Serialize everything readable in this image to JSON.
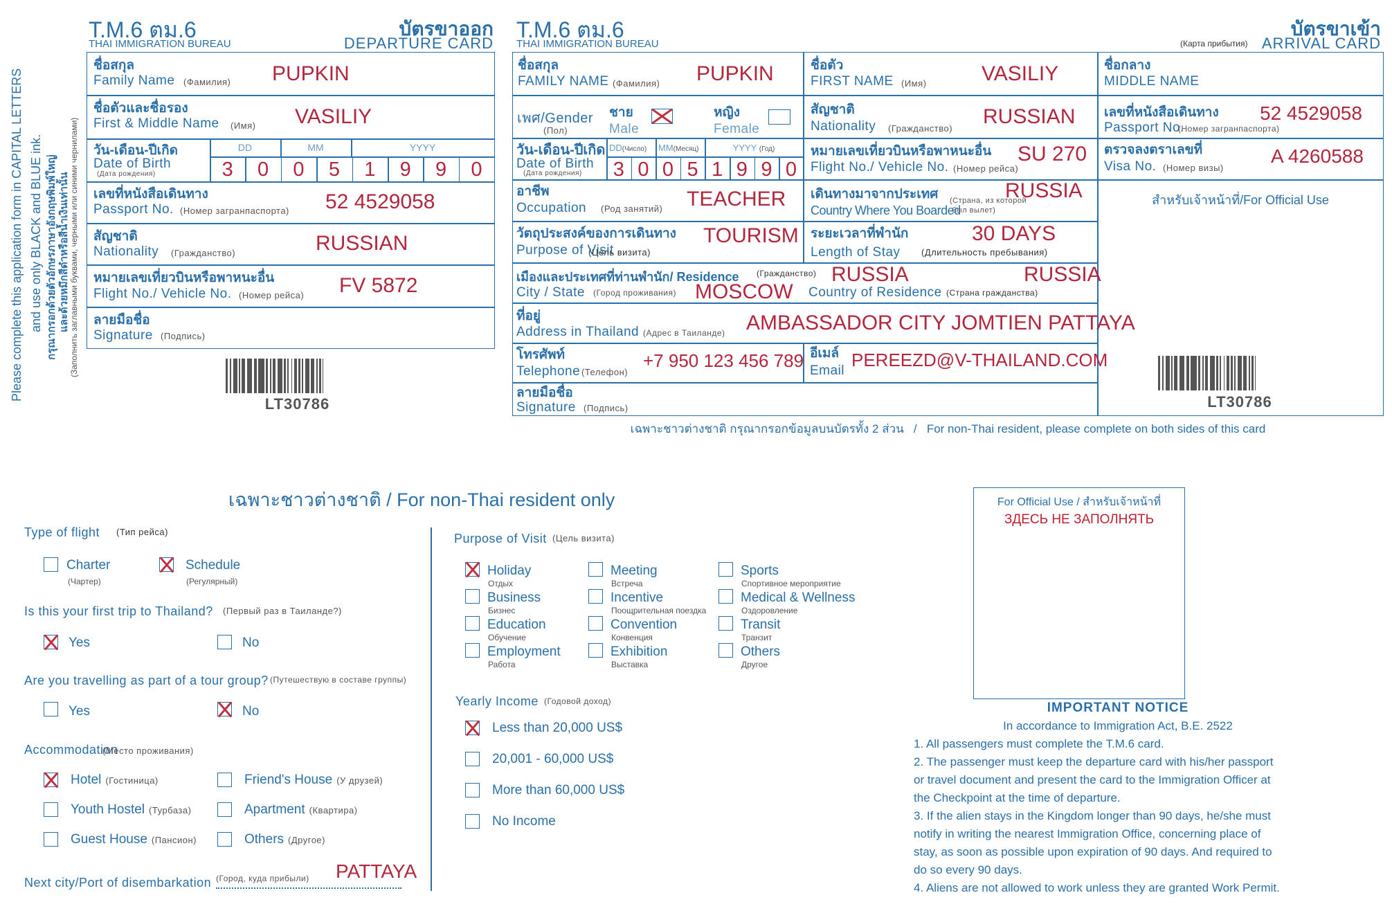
{
  "side_instructions": {
    "line1": "Please complete this application form in CAPITAL LETTERS",
    "line2": "and use only BLACK and BLUE ink.",
    "line3": "กรุณากรอกด้วยตัวอักษรภาษาอังกฤษพิมพ์ใหญ่",
    "line4": "และด้วยหมึกสีดำหรือสีน้ำเงินเท่านั้น",
    "line5": "(Заполнить заглавными буквами, черными или синими чернилами)"
  },
  "departure": {
    "form_code": "T.M.6  ตม.6",
    "bureau": "THAI IMMIGRATION BUREAU",
    "title_thai": "บัตรขาออก",
    "title_en": "DEPARTURE CARD",
    "fields": {
      "family_name": {
        "thai": "ชื่อสกุล",
        "en": "Family Name",
        "ru": "(Фамилия)",
        "value": "PUPKIN"
      },
      "first_name": {
        "thai": "ชื่อตัวและชื่อรอง",
        "en": "First & Middle Name",
        "ru": "(Имя)",
        "value": "VASILIY"
      },
      "dob": {
        "thai": "วัน-เดือน-ปีเกิด",
        "en": "Date of Birth",
        "ru": "(Дата рождения)",
        "dd_label": "DD",
        "mm_label": "MM",
        "yyyy_label": "YYYY",
        "digits": [
          "3",
          "0",
          "0",
          "5",
          "1",
          "9",
          "9",
          "0"
        ]
      },
      "passport": {
        "thai": "เลขที่หนังสือเดินทาง",
        "en": "Passport No.",
        "ru": "(Номер загранпаспорта)",
        "value": "52  4529058"
      },
      "nationality": {
        "thai": "สัญชาติ",
        "en": "Nationality",
        "ru": "(Гражданство)",
        "value": "RUSSIAN"
      },
      "flight": {
        "thai": "หมายเลขเที่ยวบินหรือพาหนะอื่น",
        "en": "Flight No./ Vehicle No.",
        "ru": "(Номер рейса)",
        "value": "FV 5872"
      },
      "signature": {
        "thai": "ลายมือชื่อ",
        "en": "Signature",
        "ru": "(Подпись)"
      }
    },
    "barcode": "LT30786"
  },
  "arrival": {
    "form_code": "T.M.6  ตม.6",
    "bureau": "THAI IMMIGRATION BUREAU",
    "title_thai": "บัตรขาเข้า",
    "title_ru": "(Карта прибытия)",
    "title_en": "ARRIVAL CARD",
    "fields": {
      "family_name": {
        "thai": "ชื่อสกุล",
        "en": "FAMILY NAME",
        "ru": "(Фамилия)",
        "value": "PUPKIN"
      },
      "first_name": {
        "thai": "ชื่อตัว",
        "en": "FIRST NAME",
        "ru": "(Имя)",
        "value": "VASILIY"
      },
      "middle_name": {
        "thai": "ชื่อกลาง",
        "en": "MIDDLE NAME",
        "value": ""
      },
      "gender": {
        "thai": "เพศ/Gender",
        "ru": "(Пол)",
        "male_thai": "ชาย",
        "male_en": "Male",
        "female_thai": "หญิง",
        "female_en": "Female",
        "male_checked": true,
        "female_checked": false
      },
      "nationality": {
        "thai": "สัญชาติ",
        "en": "Nationality",
        "ru": "(Гражданство)",
        "value": "RUSSIAN"
      },
      "passport": {
        "thai": "เลขที่หนังสือเดินทาง",
        "en": "Passport No.",
        "ru": "(Номер загранпаспорта)",
        "value": "52  4529058"
      },
      "dob": {
        "thai": "วัน-เดือน-ปีเกิด",
        "en": "Date of Birth",
        "ru": "(Дата рождения)",
        "dd_label": "DD",
        "dd_ru": "(Число)",
        "mm_label": "MM",
        "mm_ru": "(Месяц)",
        "yyyy_label": "YYYY",
        "yyyy_ru": "(Год)",
        "digits": [
          "3",
          "0",
          "0",
          "5",
          "1",
          "9",
          "9",
          "0"
        ]
      },
      "flight": {
        "thai": "หมายเลขเที่ยวบินหรือพาหนะอื่น",
        "en": "Flight No./ Vehicle No.",
        "ru": "(Номер рейса)",
        "value": "SU 270"
      },
      "visa": {
        "thai": "ตรวจลงตราเลขที่",
        "en": "Visa No.",
        "ru": "(Номер визы)",
        "value": "A 4260588"
      },
      "occupation": {
        "thai": "อาชีพ",
        "en": "Occupation",
        "ru": "(Род занятий)",
        "value": "TEACHER"
      },
      "boarded": {
        "thai": "เดินทางมาจากประเทศ",
        "en": "Country Where You Boarded",
        "ru1": "(Страна, из которой",
        "ru2": "был вылет)",
        "value": "RUSSIA"
      },
      "official_use": "สำหรับเจ้าหน้าที่/For Official Use",
      "purpose": {
        "thai": "วัตถุประสงค์ของการเดินทาง",
        "en": "Purpose of Visit",
        "ru": "(Цель визита)",
        "value": "TOURISM"
      },
      "length_of_stay": {
        "thai": "ระยะเวลาที่พำนัก",
        "en": "Length of Stay",
        "ru": "(Длительность пребывания)",
        "value": "30 DAYS"
      },
      "residence": {
        "thai": "เมืองและประเทศที่ท่านพำนัก/ Residence",
        "ru_top": "(Гражданство)",
        "city_en": "City / State",
        "city_ru": "(Город проживания)",
        "city_value": "MOSCOW",
        "country_top_value": "RUSSIA",
        "country_en": "Country of Residence",
        "country_ru": "(Страна гражданства)",
        "country_value": "RUSSIA"
      },
      "address": {
        "thai": "ที่อยู่",
        "en": "Address in Thailand",
        "ru": "(Адрес в Таиланде)",
        "value": "AMBASSADOR CITY JOMTIEN PATTAYA"
      },
      "telephone": {
        "thai": "โทรศัพท์",
        "en": "Telephone",
        "ru": "(Телефон)",
        "value": "+7 950 123 456 789"
      },
      "email": {
        "thai": "อีเมล์",
        "en": "Email",
        "value": "PEREEZD@V-THAILAND.COM"
      },
      "signature": {
        "thai": "ลายมือชื่อ",
        "en": "Signature",
        "ru": "(Подпись)"
      }
    },
    "barcode": "LT30786",
    "footer": "เฉพาะชาวต่างชาติ กรุณากรอกข้อมูลบนบัตรทั้ง 2 ส่วน   /   For non-Thai resident, please complete on both sides of this card"
  },
  "back": {
    "title": "เฉพาะชาวต่างชาติ / For non-Thai resident only",
    "type_of_flight": {
      "label": "Type of flight",
      "ru": "(Тип рейса)",
      "options": [
        {
          "label": "Charter",
          "ru": "(Чартер)",
          "checked": false
        },
        {
          "label": "Schedule",
          "ru": "(Регулярный)",
          "checked": true
        }
      ]
    },
    "first_trip": {
      "label": "Is this your first trip to Thailand?",
      "ru": "(Первый раз в Таиланде?)",
      "options": [
        {
          "label": "Yes",
          "checked": true
        },
        {
          "label": "No",
          "checked": false
        }
      ]
    },
    "tour_group": {
      "label": "Are you travelling as part of a tour group?",
      "ru": "(Путешествую в составе группы)",
      "options": [
        {
          "label": "Yes",
          "checked": false
        },
        {
          "label": "No",
          "checked": true
        }
      ]
    },
    "accommodation": {
      "label": "Accommodation",
      "ru": "(Место проживания)",
      "options": [
        {
          "label": "Hotel",
          "ru": "(Гостиница)",
          "checked": true
        },
        {
          "label": "Friend's House",
          "ru": "(У друзей)",
          "checked": false
        },
        {
          "label": "Youth Hostel",
          "ru": "(Турбаза)",
          "checked": false
        },
        {
          "label": "Apartment",
          "ru": "(Квартира)",
          "checked": false
        },
        {
          "label": "Guest House",
          "ru": "(Пансион)",
          "checked": false
        },
        {
          "label": "Others",
          "ru": "(Другое)",
          "checked": false
        }
      ]
    },
    "next_city": {
      "label": "Next city/Port of disembarkation",
      "ru": "(Город, куда прибыли)",
      "value": "PATTAYA"
    },
    "purpose": {
      "label": "Purpose of Visit",
      "ru": "(Цель визита)",
      "options": [
        {
          "label": "Holiday",
          "ru": "Отдых",
          "checked": true
        },
        {
          "label": "Meeting",
          "ru": "Встреча",
          "checked": false
        },
        {
          "label": "Sports",
          "ru": "Спортивное мероприятие",
          "checked": false
        },
        {
          "label": "Business",
          "ru": "Бизнес",
          "checked": false
        },
        {
          "label": "Incentive",
          "ru": "Поощрительная поездка",
          "checked": false
        },
        {
          "label": "Medical & Wellness",
          "ru": "Оздоровление",
          "checked": false
        },
        {
          "label": "Education",
          "ru": "Обучение",
          "checked": false
        },
        {
          "label": "Convention",
          "ru": "Конвенция",
          "checked": false
        },
        {
          "label": "Transit",
          "ru": "Транзит",
          "checked": false
        },
        {
          "label": "Employment",
          "ru": "Работа",
          "checked": false
        },
        {
          "label": "Exhibition",
          "ru": "Выставка",
          "checked": false
        },
        {
          "label": "Others",
          "ru": "Другое",
          "checked": false
        }
      ]
    },
    "income": {
      "label": "Yearly Income",
      "ru": "(Годовой доход)",
      "options": [
        {
          "label": "Less than 20,000 US$",
          "checked": true
        },
        {
          "label": "20,001 - 60,000 US$",
          "checked": false
        },
        {
          "label": "More than 60,000 US$",
          "checked": false
        },
        {
          "label": "No Income",
          "checked": false
        }
      ]
    },
    "official": {
      "title": "For Official Use / สำหรับเจ้าหน้าที่",
      "warning": "ЗДЕСЬ НЕ ЗАПОЛНЯТЬ"
    },
    "notice": {
      "title": "IMPORTANT NOTICE",
      "subtitle": "In accordance to Immigration Act, B.E. 2522",
      "lines": [
        "1. All passengers must complete the T.M.6 card.",
        "2. The passenger must keep the departure card with his/her passport",
        "or travel document and present the card to the Immigration Officer at",
        "the Checkpoint at the time of departure.",
        "3. If the alien stays in the Kingdom longer than 90 days, he/she must",
        "notify in writing the nearest Immigration Office, concerning place of",
        "stay, as soon as possible upon expiration of 90 days. And required to",
        "do so every 90 days.",
        "4. Aliens are not allowed to work unless they are granted Work Permit."
      ]
    }
  }
}
